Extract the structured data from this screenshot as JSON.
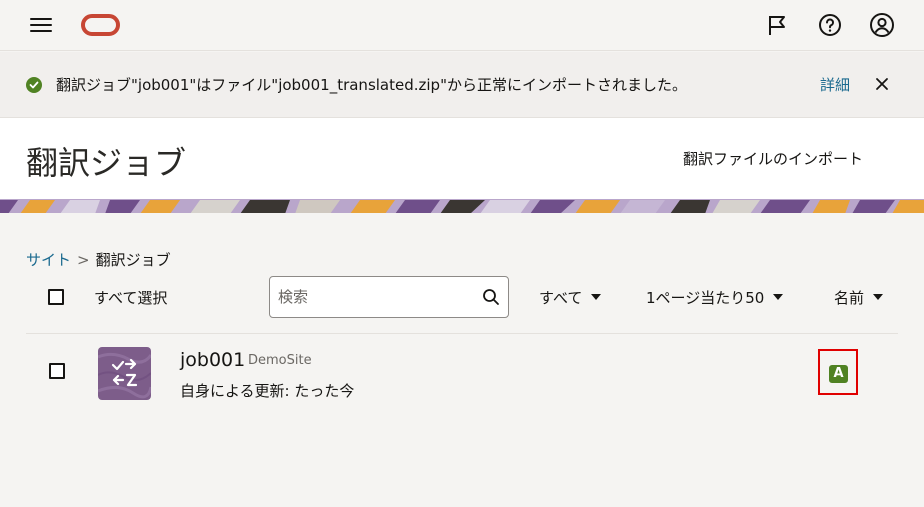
{
  "topbar": {
    "menu_icon": "hamburger-menu-icon",
    "logo_icon": "oracle-logo",
    "flag_icon": "flag-icon",
    "help_icon": "help-icon",
    "user_icon": "user-avatar-icon"
  },
  "notice": {
    "message": "翻訳ジョブ\"job001\"はファイル\"job001_translated.zip\"から正常にインポートされました。",
    "details_label": "詳細",
    "status_color": "#508223"
  },
  "header": {
    "title": "翻訳ジョブ",
    "import_label": "翻訳ファイルのインポート"
  },
  "breadcrumb": {
    "parent": "サイト",
    "separator": ">",
    "current": "翻訳ジョブ"
  },
  "toolbar": {
    "select_all_label": "すべて選択",
    "search_placeholder": "検索",
    "filter_value": "すべて",
    "per_page_value": "1ページ当たり50",
    "sort_value": "名前"
  },
  "jobs": [
    {
      "name": "job001",
      "site": "DemoSite",
      "updated": "自身による更新: たった今",
      "status_badge": "A",
      "thumb_icon": "translate-icon"
    }
  ],
  "colors": {
    "accent_link": "#1b6a8f",
    "brand": "#c74634",
    "success": "#508223",
    "highlight": "#e00000"
  }
}
